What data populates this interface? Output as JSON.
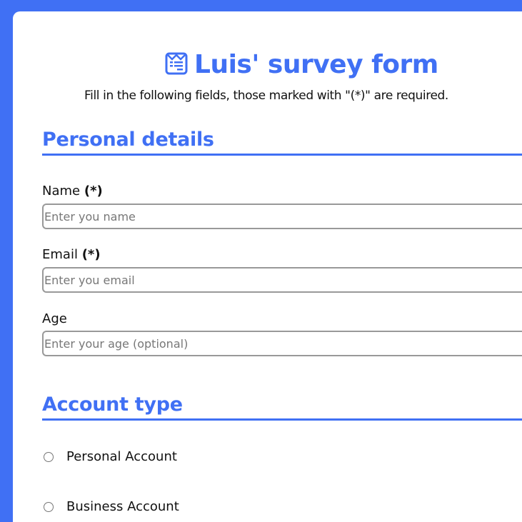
{
  "header": {
    "title": "Luis' survey form",
    "title_icon": "survey-form-icon",
    "subtitle": "Fill in the following fields, those marked with \"(*)\" are required."
  },
  "personal": {
    "heading": "Personal details",
    "name": {
      "label": "Name",
      "required_mark": "(*)",
      "placeholder": "Enter you name",
      "value": ""
    },
    "email": {
      "label": "Email",
      "required_mark": "(*)",
      "placeholder": "Enter you email",
      "value": ""
    },
    "age": {
      "label": "Age",
      "placeholder": "Enter your age (optional)",
      "value": ""
    }
  },
  "account": {
    "heading": "Account type",
    "options": [
      {
        "label": "Personal Account",
        "checked": false
      },
      {
        "label": "Business Account",
        "checked": false
      }
    ]
  },
  "colors": {
    "accent": "#4070f4"
  }
}
